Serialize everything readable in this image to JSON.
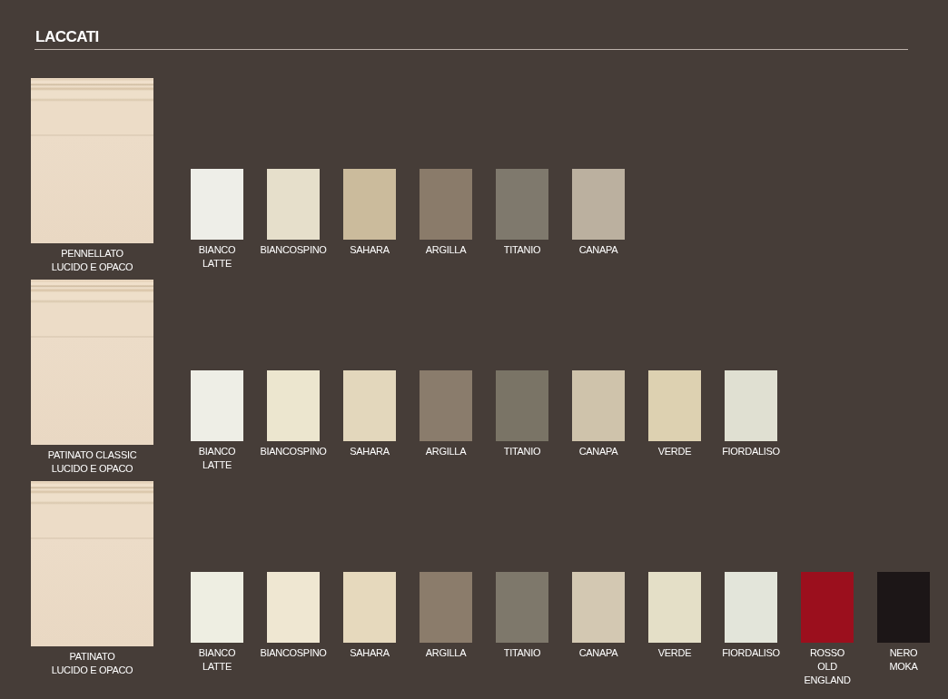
{
  "title": "LACCATI",
  "rows": [
    {
      "door_label": "PENNELLATO\nLUCIDO E OPACO",
      "swatches": [
        {
          "name": "BIANCO\nLATTE",
          "color": "#eeeee8"
        },
        {
          "name": "BIANCOSPINO",
          "color": "#e6dfcb"
        },
        {
          "name": "SAHARA",
          "color": "#cbbb9c"
        },
        {
          "name": "ARGILLA",
          "color": "#8a7b6a"
        },
        {
          "name": "TITANIO",
          "color": "#7f796d"
        },
        {
          "name": "CANAPA",
          "color": "#bbb09f"
        }
      ]
    },
    {
      "door_label": "PATINATO CLASSIC\nLUCIDO E OPACO",
      "swatches": [
        {
          "name": "BIANCO\nLATTE",
          "color": "#eeeee6"
        },
        {
          "name": "BIANCOSPINO",
          "color": "#ece6cf"
        },
        {
          "name": "SAHARA",
          "color": "#e3d7bc"
        },
        {
          "name": "ARGILLA",
          "color": "#8a7c6c"
        },
        {
          "name": "TITANIO",
          "color": "#7a7466"
        },
        {
          "name": "CANAPA",
          "color": "#cfc3ab"
        },
        {
          "name": "VERDE",
          "color": "#ddd1b1"
        },
        {
          "name": "FIORDALISO",
          "color": "#e0e0d2"
        }
      ]
    },
    {
      "door_label": "PATINATO\nLUCIDO E OPACO",
      "swatches": [
        {
          "name": "BIANCO\nLATTE",
          "color": "#eeeee2"
        },
        {
          "name": "BIANCOSPINO",
          "color": "#efe7d2"
        },
        {
          "name": "SAHARA",
          "color": "#e6d9bd"
        },
        {
          "name": "ARGILLA",
          "color": "#8b7c6b"
        },
        {
          "name": "TITANIO",
          "color": "#7e786b"
        },
        {
          "name": "CANAPA",
          "color": "#d3c8b2"
        },
        {
          "name": "VERDE",
          "color": "#e4dfc7"
        },
        {
          "name": "FIORDALISO",
          "color": "#e3e5da"
        },
        {
          "name": "ROSSO\nOLD\nENGLAND",
          "color": "#9b0f1d"
        },
        {
          "name": "NERO\nMOKA",
          "color": "#1c1617"
        }
      ]
    }
  ]
}
